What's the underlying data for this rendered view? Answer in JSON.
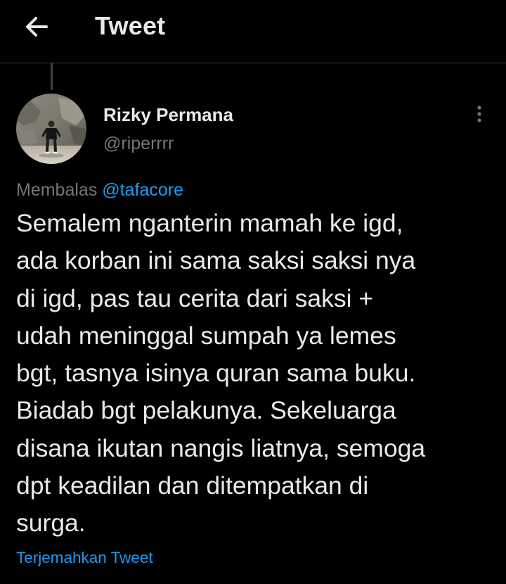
{
  "header": {
    "back_icon": "arrow-left-icon",
    "title": "Tweet"
  },
  "tweet": {
    "author": {
      "display_name": "Rizky Permana",
      "handle": "@riperrrr"
    },
    "more_icon": "more-vertical-icon",
    "reply_prefix": "Membalas",
    "reply_mention": "@tafacore",
    "body_lines": [
      "Semalem nganterin mamah ke igd,",
      "ada korban ini sama saksi saksi nya",
      "di igd, pas tau cerita dari saksi +",
      "udah meninggal sumpah ya lemes",
      "bgt, tasnya isinya quran sama buku.",
      "Biadab bgt pelakunya. Sekeluarga",
      "disana ikutan nangis liatnya, semoga",
      "dpt keadilan dan ditempatkan di",
      "surga."
    ],
    "translate_label": "Terjemahkan Tweet"
  },
  "colors": {
    "background": "#000000",
    "text_primary": "#e7e9ea",
    "text_secondary": "#71767b",
    "accent": "#1d9bf0",
    "divider": "#2f3336"
  }
}
